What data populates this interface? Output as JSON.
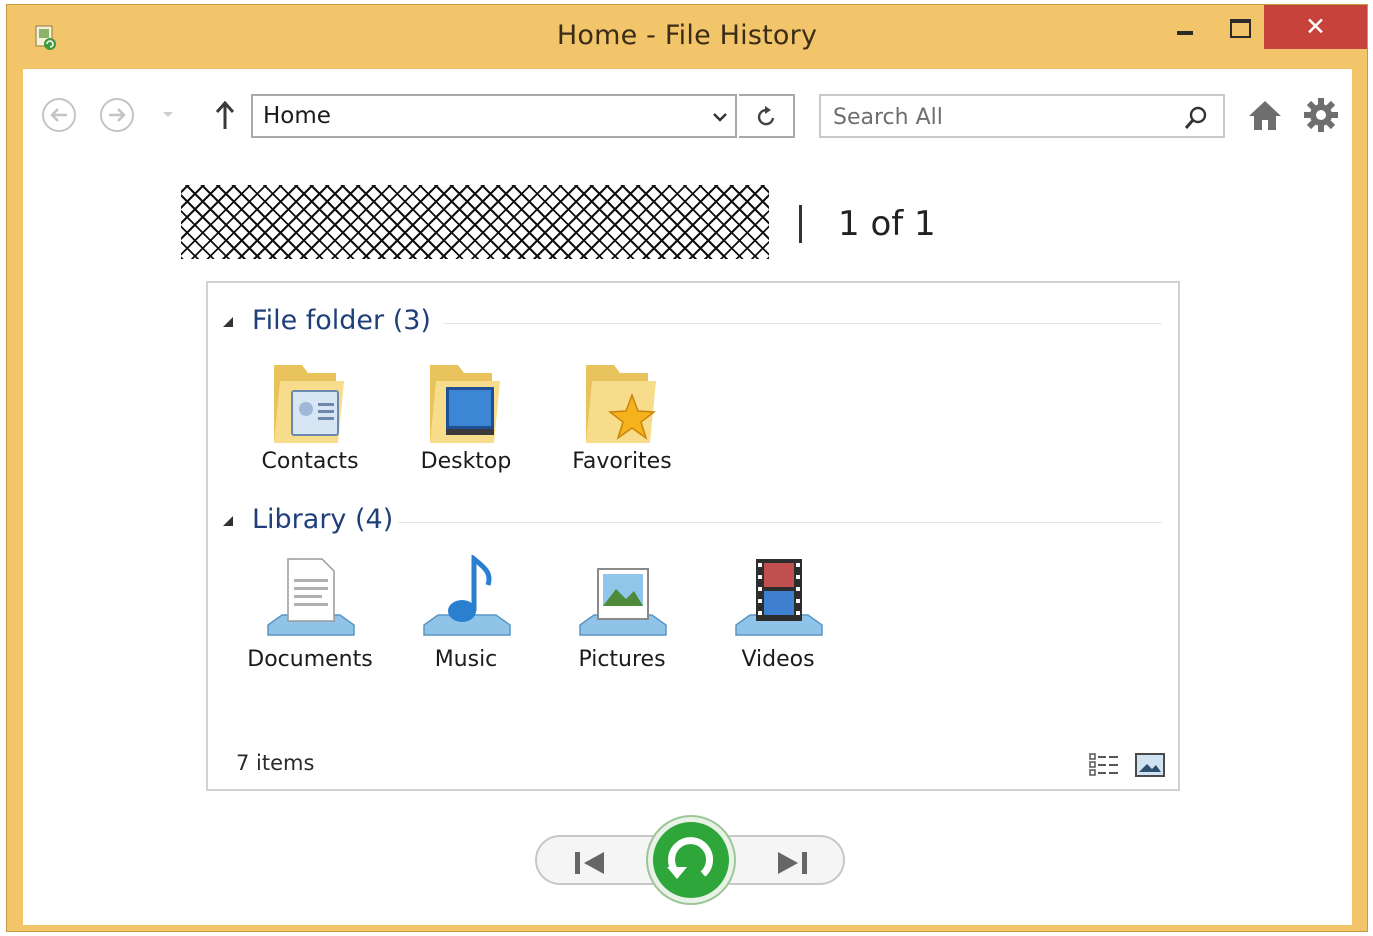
{
  "window": {
    "title": "Home - File History",
    "close_glyph": "✕"
  },
  "toolbar": {
    "address_value": "Home",
    "search_placeholder": "Search All"
  },
  "snapshot": {
    "separator": "|",
    "counter": "1 of 1"
  },
  "groups": [
    {
      "title": "File folder (3)",
      "items": [
        {
          "label": "Contacts",
          "icon": "contacts-folder-icon"
        },
        {
          "label": "Desktop",
          "icon": "desktop-folder-icon"
        },
        {
          "label": "Favorites",
          "icon": "favorites-folder-icon"
        }
      ]
    },
    {
      "title": "Library (4)",
      "items": [
        {
          "label": "Documents",
          "icon": "documents-library-icon"
        },
        {
          "label": "Music",
          "icon": "music-library-icon"
        },
        {
          "label": "Pictures",
          "icon": "pictures-library-icon"
        },
        {
          "label": "Videos",
          "icon": "videos-library-icon"
        }
      ]
    }
  ],
  "status": {
    "item_count": "7 items"
  },
  "colors": {
    "title_bar": "#f3c56a",
    "close_button": "#c8423c",
    "group_title": "#1e3f7a",
    "restore_button": "#2fa63a"
  }
}
